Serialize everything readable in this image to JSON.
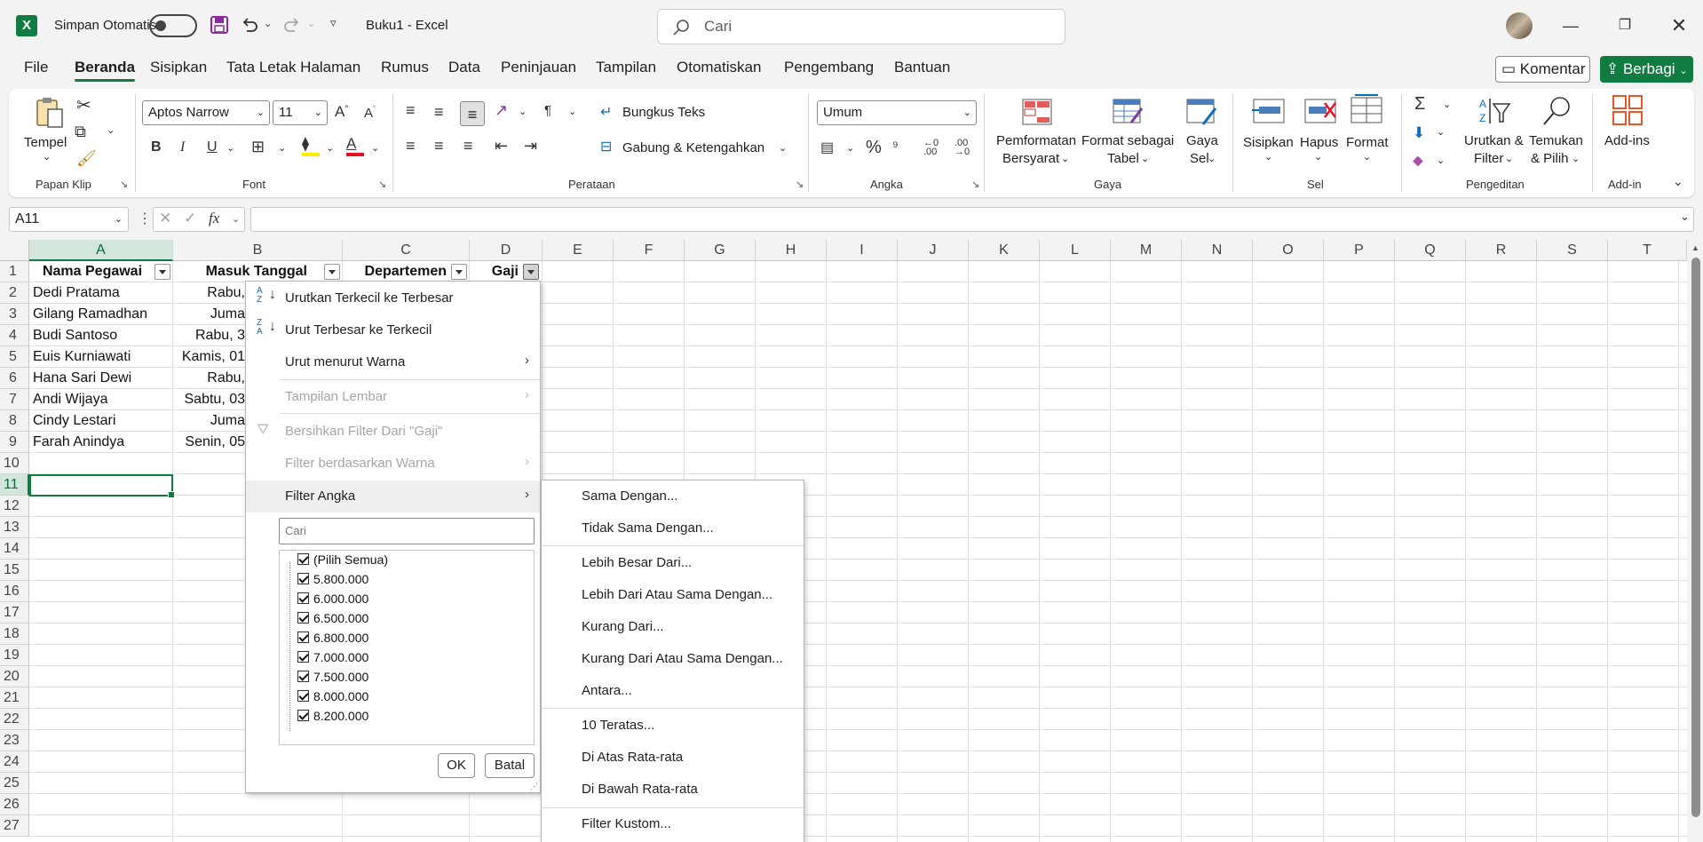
{
  "titlebar": {
    "autosave_label": "Simpan Otomatis",
    "doc_title": "Buku1  -  Excel",
    "search_placeholder": "Cari"
  },
  "menu": {
    "tabs": [
      "File",
      "Beranda",
      "Sisipkan",
      "Tata Letak Halaman",
      "Rumus",
      "Data",
      "Peninjauan",
      "Tampilan",
      "Otomatiskan",
      "Pengembang",
      "Bantuan"
    ],
    "active": "Beranda",
    "comment_label": "Komentar",
    "share_label": "Berbagi"
  },
  "ribbon": {
    "clipboard": {
      "paste_label": "Tempel",
      "group": "Papan Klip"
    },
    "font": {
      "name": "Aptos Narrow",
      "size": "11",
      "group": "Font",
      "bold": "B",
      "italic": "I",
      "underline": "U"
    },
    "alignment": {
      "wrap_label": "Bungkus Teks",
      "merge_label": "Gabung & Ketengahkan",
      "group": "Perataan"
    },
    "number": {
      "format": "Umum",
      "group": "Angka"
    },
    "styles": {
      "cond_format_1": "Pemformatan",
      "cond_format_2": "Bersyarat",
      "format_table_1": "Format sebagai",
      "format_table_2": "Tabel",
      "cell_styles_1": "Gaya",
      "cell_styles_2": "Sel",
      "group": "Gaya"
    },
    "cells": {
      "insert_label": "Sisipkan",
      "delete_label": "Hapus",
      "format_label": "Format",
      "group": "Sel"
    },
    "editing": {
      "sort_1": "Urutkan &",
      "sort_2": "Filter",
      "find_1": "Temukan",
      "find_2": "& Pilih",
      "group": "Pengeditan"
    },
    "addins": {
      "label": "Add-ins",
      "group": "Add-in"
    }
  },
  "formula_bar": {
    "name_box": "A11",
    "formula": ""
  },
  "sheet": {
    "columns": [
      "A",
      "B",
      "C",
      "D",
      "E",
      "F",
      "G",
      "H",
      "I",
      "J",
      "K",
      "L",
      "M",
      "N",
      "O",
      "P",
      "Q",
      "R",
      "S",
      "T"
    ],
    "rows": [
      "1",
      "2",
      "3",
      "4",
      "5",
      "6",
      "7",
      "8",
      "9",
      "10",
      "11",
      "12",
      "13",
      "14",
      "15",
      "16",
      "17",
      "18",
      "19",
      "20",
      "21",
      "22",
      "23",
      "24",
      "25",
      "26",
      "27"
    ],
    "headers": [
      "Nama Pegawai",
      "Masuk Tanggal",
      "Departemen",
      "Gaji"
    ],
    "names": [
      "Dedi Pratama",
      "Gilang Ramadhan",
      "Budi Santoso",
      "Euis Kurniawati",
      "Hana Sari Dewi",
      "Andi Wijaya",
      "Cindy Lestari",
      "Farah Anindya"
    ],
    "dates": [
      "Rabu,",
      "Juma",
      "Rabu, 3",
      "Kamis, 01",
      "Rabu,",
      "Sabtu, 03",
      "Juma",
      "Senin, 05"
    ]
  },
  "filter_menu": {
    "sort_asc": "Urutkan Terkecil ke Terbesar",
    "sort_desc": "Urut Terbesar ke Terkecil",
    "sort_color": "Urut menurut Warna",
    "sheet_view": "Tampilan Lembar",
    "clear_filter": "Bersihkan Filter Dari \"Gaji\"",
    "filter_color": "Filter berdasarkan Warna",
    "number_filter": "Filter Angka",
    "search_placeholder": "Cari",
    "values": [
      "(Pilih Semua)",
      "5.800.000",
      "6.000.000",
      "6.500.000",
      "6.800.000",
      "7.000.000",
      "7.500.000",
      "8.000.000",
      "8.200.000"
    ],
    "ok": "OK",
    "cancel": "Batal"
  },
  "number_filter_submenu": {
    "items": [
      "Sama Dengan...",
      "Tidak Sama Dengan...",
      "Lebih Besar Dari...",
      "Lebih Dari Atau Sama Dengan...",
      "Kurang Dari...",
      "Kurang Dari Atau Sama Dengan...",
      "Antara...",
      "10 Teratas...",
      "Di Atas Rata-rata",
      "Di Bawah Rata-rata",
      "Filter Kustom..."
    ]
  },
  "colors": {
    "accent": "#107c41",
    "selection_header": "#d3e6db"
  }
}
